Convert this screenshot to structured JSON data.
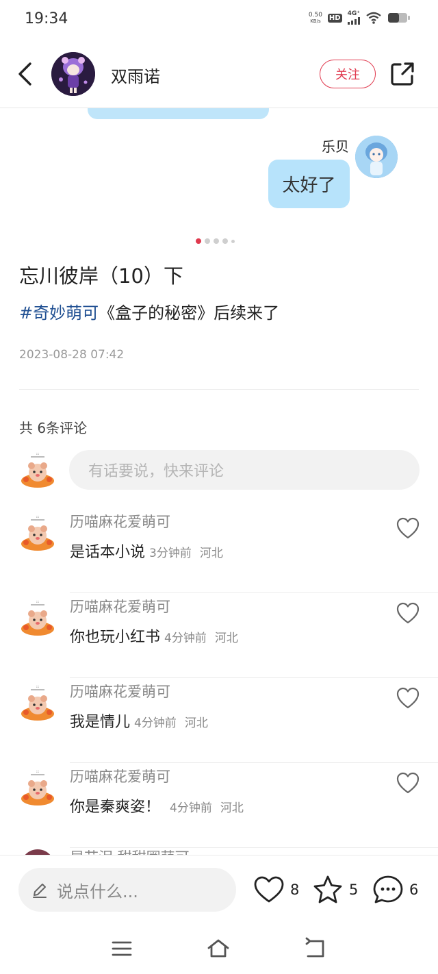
{
  "status_bar": {
    "time": "19:34",
    "speed_value": "0.50",
    "speed_unit": "KB/s",
    "hd": "HD",
    "network": "4G⁺",
    "icons": [
      "signal-icon",
      "wifi-icon",
      "battery-icon"
    ]
  },
  "header": {
    "back_icon": "back-arrow-icon",
    "user_name": "双雨诺",
    "follow_label": "关注",
    "share_icon": "share-icon",
    "accent_color": "#e0394e"
  },
  "carousel": {
    "chat_sender": "乐贝",
    "chat_message": "太好了",
    "bubble_color": "#b7e3fb",
    "page_count": 5,
    "active_index": 0
  },
  "post": {
    "title": "忘川彼岸（10）下",
    "hashtag": "#奇妙萌可",
    "description": "《盒子的秘密》后续来了",
    "date": "2023-08-28 07:42",
    "hashtag_color": "#1f4f92"
  },
  "comments_section": {
    "count_label": "共 6条评论",
    "input_placeholder": "有话要说，快来评论",
    "comments": [
      {
        "author": "历喵麻花爱萌可",
        "text": "是话本小说",
        "time": "3分钟前",
        "location": "河北"
      },
      {
        "author": "历喵麻花爱萌可",
        "text": "你也玩小红书",
        "time": "4分钟前",
        "location": "河北"
      },
      {
        "author": "历喵麻花爱萌可",
        "text": "我是情儿",
        "time": "4分钟前",
        "location": "河北"
      },
      {
        "author": "历喵麻花爱萌可",
        "text": "你是秦爽姿！",
        "time": "4分钟前",
        "location": "河北"
      }
    ],
    "partial_author": "早苗泪 甜甜圈萌可"
  },
  "bottom_bar": {
    "placeholder": "说点什么...",
    "likes": "8",
    "stars": "5",
    "comments": "6"
  },
  "nav_bar": {
    "icons": [
      "menu-icon",
      "home-icon",
      "back-icon"
    ]
  }
}
